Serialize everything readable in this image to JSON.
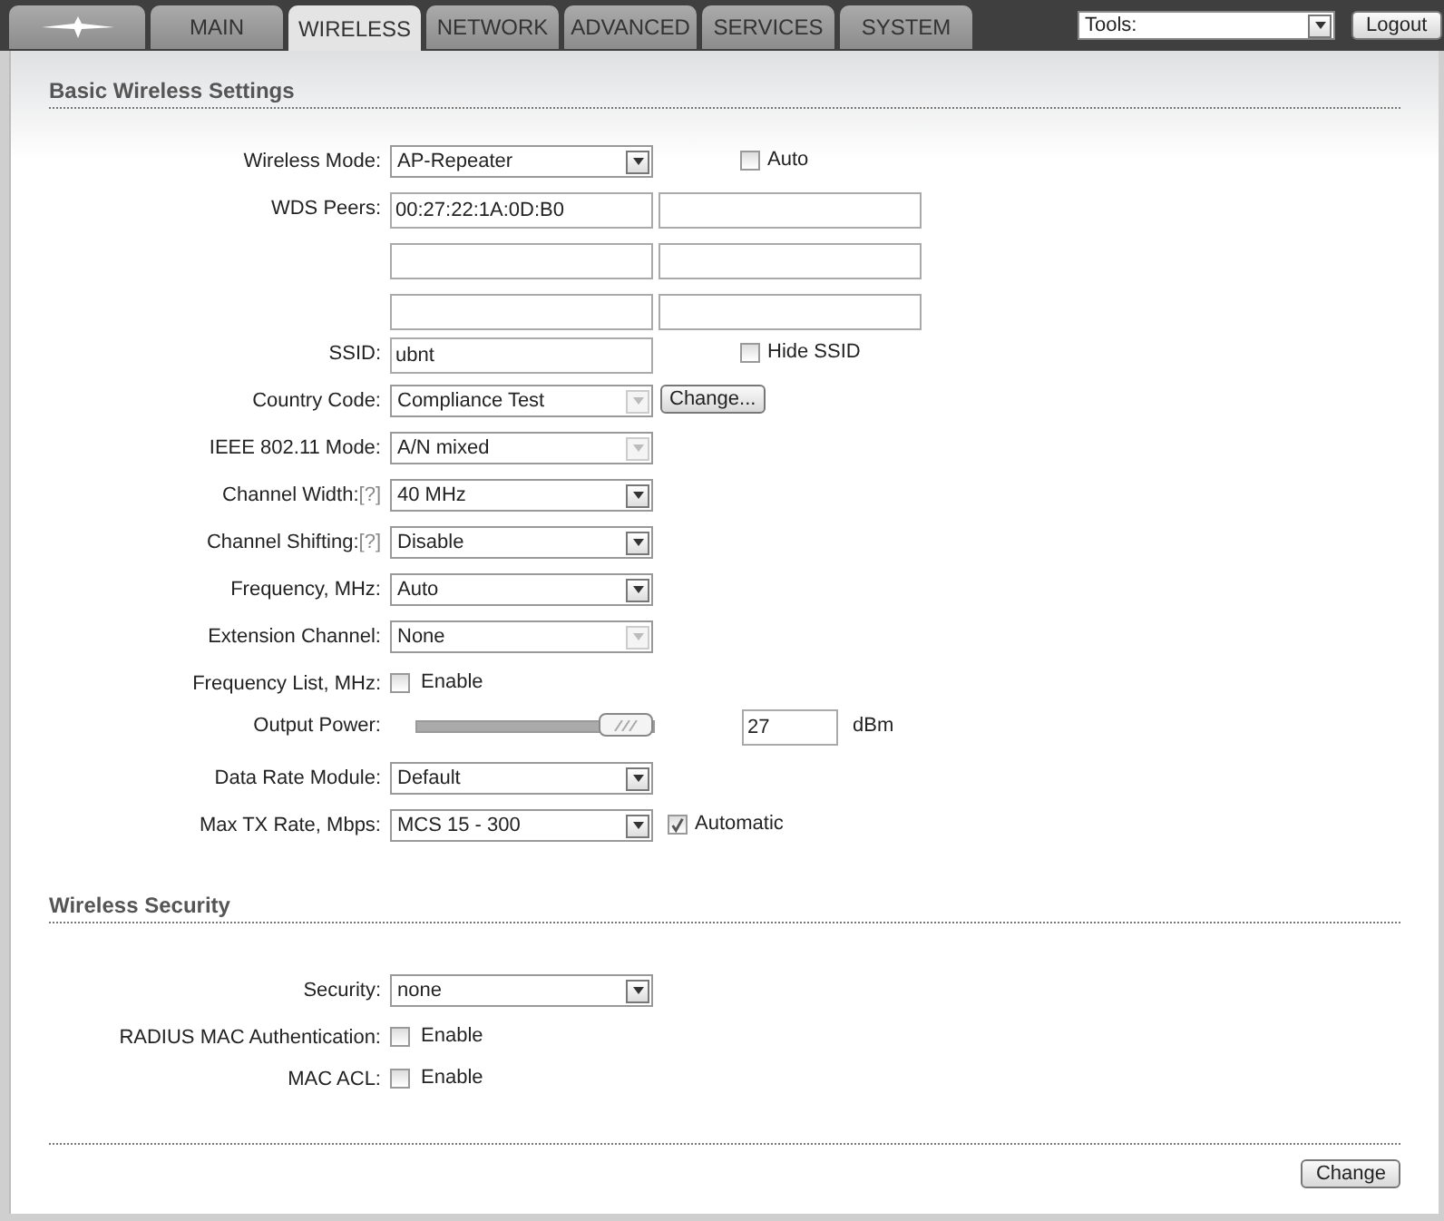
{
  "tabs": [
    {
      "kind": "logo",
      "selected": false
    },
    {
      "kind": "text",
      "label": "MAIN",
      "selected": false
    },
    {
      "kind": "text",
      "label": "WIRELESS",
      "selected": true
    },
    {
      "kind": "text",
      "label": "NETWORK",
      "selected": false
    },
    {
      "kind": "text",
      "label": "ADVANCED",
      "selected": false
    },
    {
      "kind": "text",
      "label": "SERVICES",
      "selected": false
    },
    {
      "kind": "text",
      "label": "SYSTEM",
      "selected": false
    }
  ],
  "tools": {
    "value": "Tools:"
  },
  "logout": "Logout",
  "sections": [
    {
      "title": "Basic Wireless Settings",
      "rows": [
        {
          "kind": "select",
          "label": "Wireless Mode:",
          "value": "AP-Repeater",
          "disabled": false,
          "extra": {
            "kind": "checkbox",
            "label": "Auto",
            "checked": false
          }
        },
        {
          "kind": "inputs",
          "label": "WDS Peers:",
          "fields": [
            {
              "kind": "filled",
              "value": "00:27:22:1A:0D:B0"
            },
            {
              "kind": "empty"
            },
            {
              "kind": "empty"
            },
            {
              "kind": "empty"
            },
            {
              "kind": "empty"
            },
            {
              "kind": "empty"
            }
          ]
        },
        {
          "kind": "input",
          "label": "SSID:",
          "value": "ubnt",
          "extra": {
            "kind": "checkbox",
            "label": "Hide SSID",
            "checked": false
          }
        },
        {
          "kind": "select",
          "label": "Country Code:",
          "value": "Compliance Test",
          "disabled": true,
          "extra": {
            "kind": "button",
            "label": "Change..."
          }
        },
        {
          "kind": "select",
          "label": "IEEE 802.11 Mode:",
          "value": "A/N mixed",
          "disabled": true
        },
        {
          "kind": "select",
          "label": "Channel Width:",
          "help": "[?]",
          "value": "40 MHz",
          "disabled": false
        },
        {
          "kind": "select",
          "label": "Channel Shifting:",
          "help": "[?]",
          "value": "Disable",
          "disabled": false
        },
        {
          "kind": "select",
          "label": "Frequency, MHz:",
          "value": "Auto",
          "disabled": false
        },
        {
          "kind": "select",
          "label": "Extension Channel:",
          "value": "None",
          "disabled": true
        },
        {
          "kind": "checkbox",
          "label": "Frequency List, MHz:",
          "text": "Enable",
          "checked": false
        },
        {
          "kind": "slider",
          "label": "Output Power:",
          "level": 1,
          "value": "27",
          "unit": "dBm"
        },
        {
          "kind": "select",
          "label": "Data Rate Module:",
          "value": "Default",
          "disabled": false
        },
        {
          "kind": "select",
          "label": "Max TX Rate, Mbps:",
          "value": "MCS 15 - 300",
          "disabled": false,
          "extra": {
            "kind": "checkbox",
            "label": "Automatic",
            "checked": true
          }
        }
      ]
    },
    {
      "title": "Wireless Security",
      "rows": [
        {
          "kind": "select",
          "label": "Security:",
          "value": "none",
          "disabled": false
        },
        {
          "kind": "checkbox",
          "label": "RADIUS MAC Authentication:",
          "text": "Enable",
          "checked": false
        },
        {
          "kind": "checkbox",
          "label": "MAC ACL:",
          "text": "Enable",
          "checked": false
        }
      ]
    }
  ],
  "submit": "Change"
}
